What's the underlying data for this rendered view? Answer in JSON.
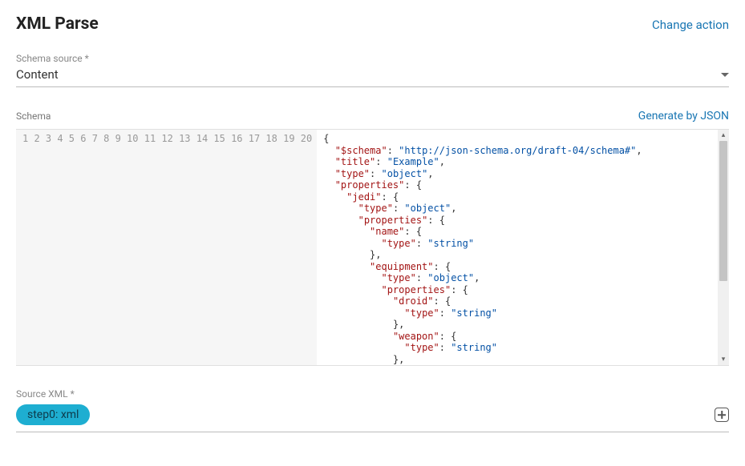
{
  "header": {
    "title": "XML Parse",
    "change_action": "Change action"
  },
  "schema_source": {
    "label": "Schema source *",
    "value": "Content"
  },
  "schema": {
    "label": "Schema",
    "generate_link": "Generate by JSON",
    "code_lines": [
      [
        {
          "t": "punct",
          "v": "{"
        }
      ],
      [
        {
          "t": "ws",
          "v": "  "
        },
        {
          "t": "key",
          "v": "\"$schema\""
        },
        {
          "t": "punct",
          "v": ": "
        },
        {
          "t": "str",
          "v": "\"http://json-schema.org/draft-04/schema#\""
        },
        {
          "t": "punct",
          "v": ","
        }
      ],
      [
        {
          "t": "ws",
          "v": "  "
        },
        {
          "t": "key",
          "v": "\"title\""
        },
        {
          "t": "punct",
          "v": ": "
        },
        {
          "t": "str",
          "v": "\"Example\""
        },
        {
          "t": "punct",
          "v": ","
        }
      ],
      [
        {
          "t": "ws",
          "v": "  "
        },
        {
          "t": "key",
          "v": "\"type\""
        },
        {
          "t": "punct",
          "v": ": "
        },
        {
          "t": "str",
          "v": "\"object\""
        },
        {
          "t": "punct",
          "v": ","
        }
      ],
      [
        {
          "t": "ws",
          "v": "  "
        },
        {
          "t": "key",
          "v": "\"properties\""
        },
        {
          "t": "punct",
          "v": ": {"
        }
      ],
      [
        {
          "t": "ws",
          "v": "    "
        },
        {
          "t": "key",
          "v": "\"jedi\""
        },
        {
          "t": "punct",
          "v": ": {"
        }
      ],
      [
        {
          "t": "ws",
          "v": "      "
        },
        {
          "t": "key",
          "v": "\"type\""
        },
        {
          "t": "punct",
          "v": ": "
        },
        {
          "t": "str",
          "v": "\"object\""
        },
        {
          "t": "punct",
          "v": ","
        }
      ],
      [
        {
          "t": "ws",
          "v": "      "
        },
        {
          "t": "key",
          "v": "\"properties\""
        },
        {
          "t": "punct",
          "v": ": {"
        }
      ],
      [
        {
          "t": "ws",
          "v": "        "
        },
        {
          "t": "key",
          "v": "\"name\""
        },
        {
          "t": "punct",
          "v": ": {"
        }
      ],
      [
        {
          "t": "ws",
          "v": "          "
        },
        {
          "t": "key",
          "v": "\"type\""
        },
        {
          "t": "punct",
          "v": ": "
        },
        {
          "t": "str",
          "v": "\"string\""
        }
      ],
      [
        {
          "t": "ws",
          "v": "        "
        },
        {
          "t": "punct",
          "v": "},"
        }
      ],
      [
        {
          "t": "ws",
          "v": "        "
        },
        {
          "t": "key",
          "v": "\"equipment\""
        },
        {
          "t": "punct",
          "v": ": {"
        }
      ],
      [
        {
          "t": "ws",
          "v": "          "
        },
        {
          "t": "key",
          "v": "\"type\""
        },
        {
          "t": "punct",
          "v": ": "
        },
        {
          "t": "str",
          "v": "\"object\""
        },
        {
          "t": "punct",
          "v": ","
        }
      ],
      [
        {
          "t": "ws",
          "v": "          "
        },
        {
          "t": "key",
          "v": "\"properties\""
        },
        {
          "t": "punct",
          "v": ": {"
        }
      ],
      [
        {
          "t": "ws",
          "v": "            "
        },
        {
          "t": "key",
          "v": "\"droid\""
        },
        {
          "t": "punct",
          "v": ": {"
        }
      ],
      [
        {
          "t": "ws",
          "v": "              "
        },
        {
          "t": "key",
          "v": "\"type\""
        },
        {
          "t": "punct",
          "v": ": "
        },
        {
          "t": "str",
          "v": "\"string\""
        }
      ],
      [
        {
          "t": "ws",
          "v": "            "
        },
        {
          "t": "punct",
          "v": "},"
        }
      ],
      [
        {
          "t": "ws",
          "v": "            "
        },
        {
          "t": "key",
          "v": "\"weapon\""
        },
        {
          "t": "punct",
          "v": ": {"
        }
      ],
      [
        {
          "t": "ws",
          "v": "              "
        },
        {
          "t": "key",
          "v": "\"type\""
        },
        {
          "t": "punct",
          "v": ": "
        },
        {
          "t": "str",
          "v": "\"string\""
        }
      ],
      [
        {
          "t": "ws",
          "v": "            "
        },
        {
          "t": "punct",
          "v": "},"
        }
      ]
    ]
  },
  "source_xml": {
    "label": "Source XML *",
    "chip": "step0: xml"
  }
}
